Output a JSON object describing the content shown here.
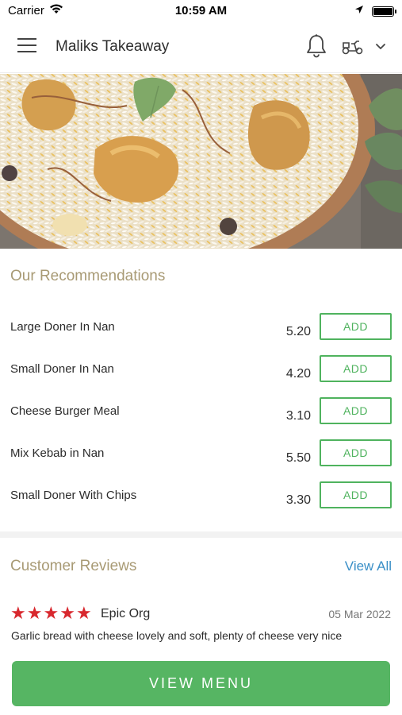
{
  "status_bar": {
    "carrier": "Carrier",
    "time": "10:59 AM"
  },
  "header": {
    "title": "Maliks Takeaway",
    "icons": [
      "menu-icon",
      "bell-icon",
      "scooter-icon",
      "chevron-down-icon"
    ]
  },
  "recommendations": {
    "title": "Our Recommendations",
    "add_label": "ADD",
    "items": [
      {
        "name": "Large Doner In Nan",
        "price": "5.20"
      },
      {
        "name": "Small Doner In Nan",
        "price": "4.20"
      },
      {
        "name": "Cheese Burger Meal",
        "price": "3.10"
      },
      {
        "name": "Mix Kebab in Nan",
        "price": "5.50"
      },
      {
        "name": "Small Doner With Chips",
        "price": "3.30"
      }
    ]
  },
  "reviews": {
    "title": "Customer Reviews",
    "view_all": "View All",
    "items": [
      {
        "rating": 5,
        "reviewer": "Epic Org",
        "date": "05 Mar 2022",
        "text": "Garlic bread with cheese lovely and soft, plenty of cheese very nice"
      }
    ]
  },
  "footer": {
    "view_menu": "VIEW MENU"
  },
  "colors": {
    "accent_green": "#56b563",
    "section_title": "#a89a74",
    "link_blue": "#3a8fc7",
    "star_red": "#d8282e"
  }
}
